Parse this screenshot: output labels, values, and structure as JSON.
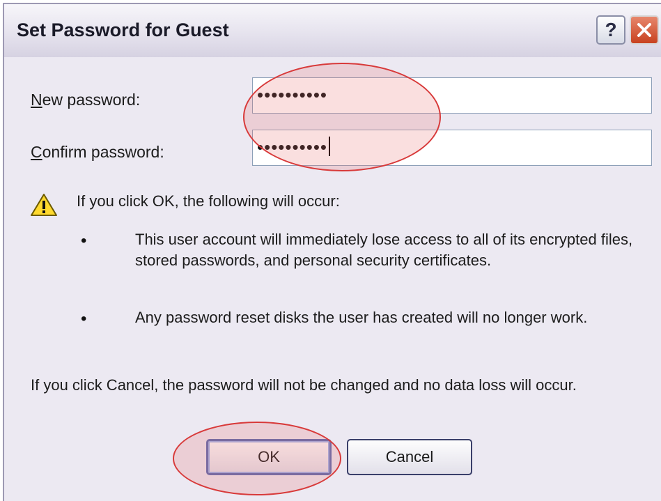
{
  "dialog": {
    "title": "Set Password for Guest",
    "help_label": "?",
    "close_icon": "close-icon"
  },
  "fields": {
    "new_password": {
      "label_accel": "N",
      "label_rest": "ew password:",
      "value": "••••••••••"
    },
    "confirm_password": {
      "label_accel": "C",
      "label_rest": "onfirm password:",
      "value": "••••••••••"
    }
  },
  "warning": {
    "icon": "warning-icon",
    "intro": "If you click OK, the following will occur:",
    "bullet_glyph": "•",
    "items": [
      "This user account will immediately lose access to all of its encrypted files, stored passwords, and personal security certificates.",
      "Any password reset disks the user has created will no longer work."
    ]
  },
  "cancel_note": "If you click Cancel, the password will not be changed and no data loss will occur.",
  "buttons": {
    "ok": "OK",
    "cancel": "Cancel"
  },
  "colors": {
    "annotation": "#d83a3a",
    "dialog_bg": "#ece9f2",
    "close_button": "#c8411f"
  }
}
